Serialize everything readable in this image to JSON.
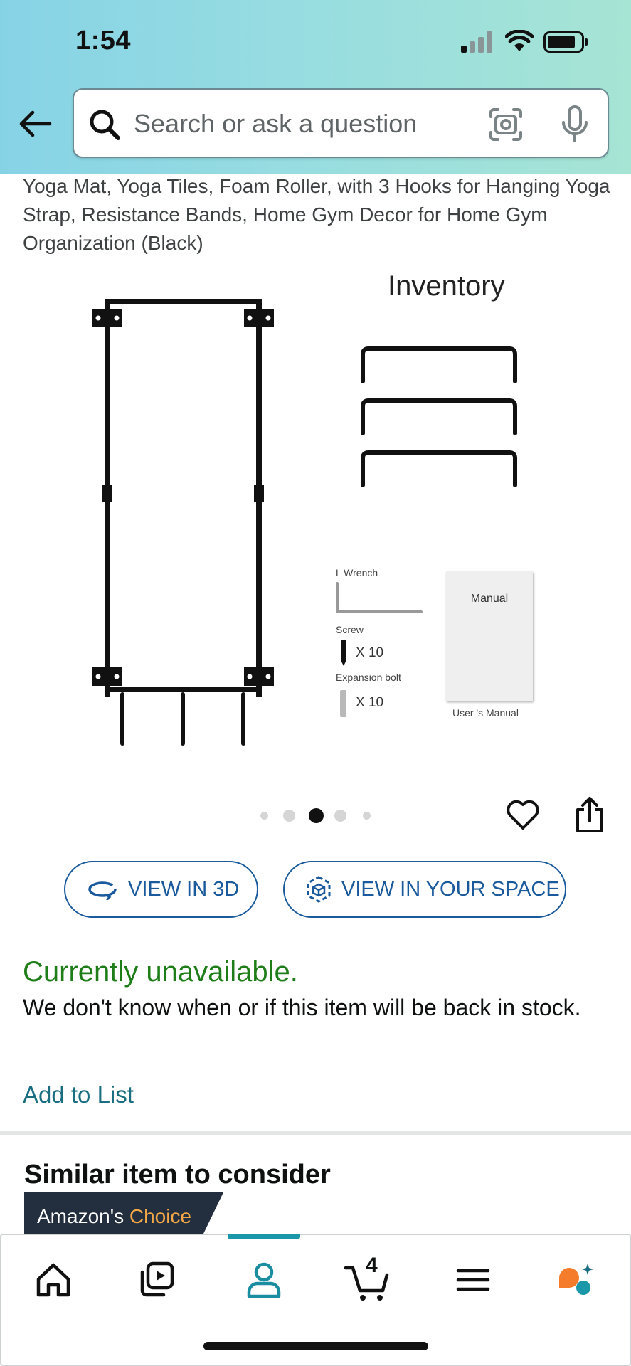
{
  "status_bar": {
    "time": "1:54"
  },
  "search": {
    "placeholder": "Search or ask a question"
  },
  "product": {
    "title": "Yoga Mat, Yoga Tiles, Foam Roller, with 3 Hooks for Hanging Yoga Strap, Resistance Bands, Home Gym Decor for Home Gym Organization (Black)",
    "image": {
      "inventory_title": "Inventory",
      "l_wrench": "L Wrench",
      "screw": "Screw",
      "screw_qty": "X 10",
      "expansion_bolt": "Expansion bolt",
      "bolt_qty": "X 10",
      "manual": "Manual",
      "user_manual": "User 's Manual"
    },
    "carousel": {
      "count": 5,
      "active_index": 2
    }
  },
  "buttons": {
    "view_3d": "VIEW IN 3D",
    "view_space": "VIEW IN YOUR SPACE"
  },
  "availability": {
    "status": "Currently unavailable.",
    "description": "We don't know when or if this item will be back in stock."
  },
  "add_to_list": "Add to List",
  "similar": {
    "heading": "Similar item to consider",
    "badge_prefix": "Amazon's",
    "badge_accent": "Choice"
  },
  "bottom_nav": {
    "cart_count": "4",
    "items": [
      "home-icon",
      "video-icon",
      "account-icon",
      "cart-icon",
      "menu-icon",
      "rufus-icon"
    ],
    "active": "account-icon"
  },
  "colors": {
    "header_gradient_start": "#87d3e6",
    "header_gradient_end": "#a6e4d4",
    "unavailable_green": "#1e7d18",
    "link_teal": "#1b6e82",
    "button_blue": "#1a5a9c",
    "badge_dark": "#232f3e",
    "badge_orange": "#f3a847"
  }
}
